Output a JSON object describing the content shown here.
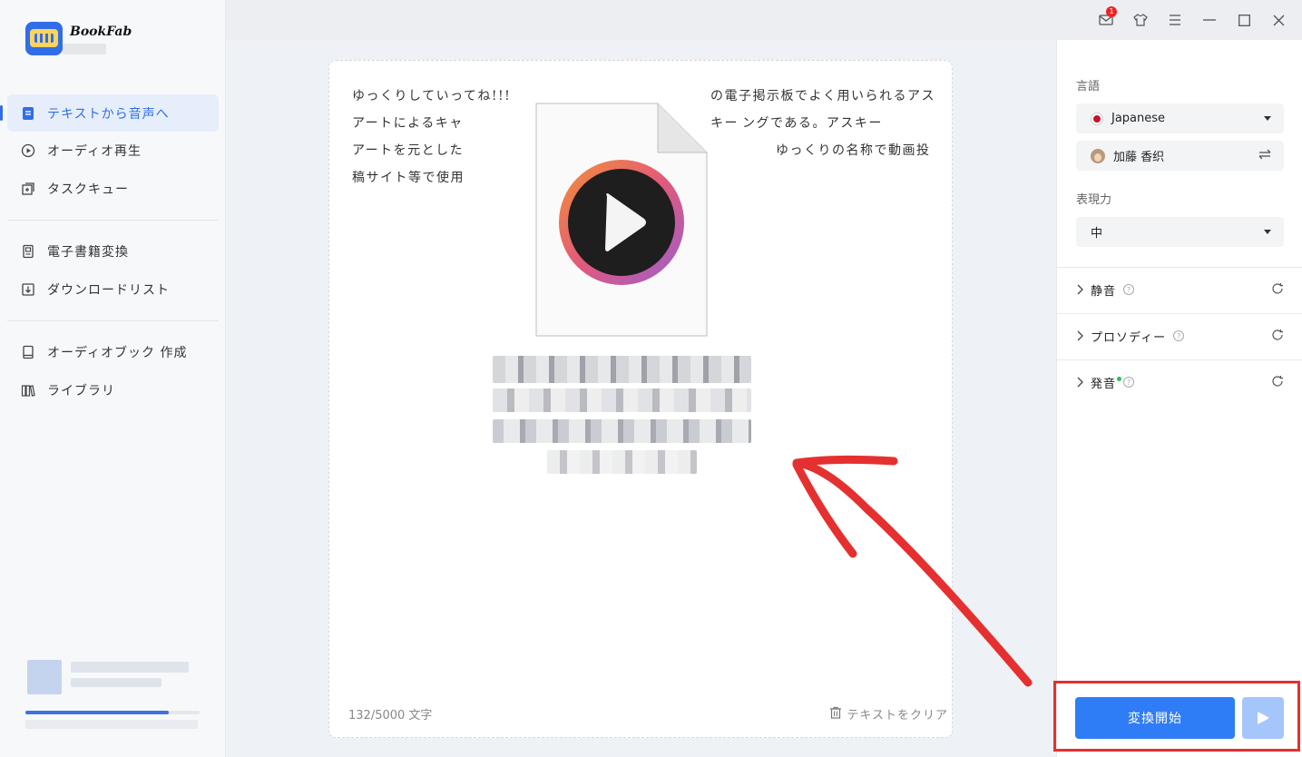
{
  "app": {
    "name": "BookFab"
  },
  "sidebar": {
    "items": [
      {
        "label": "テキストから音声へ",
        "icon": "document-icon",
        "active": true
      },
      {
        "label": "オーディオ再生",
        "icon": "play-circle-icon",
        "active": false
      },
      {
        "label": "タスクキュー",
        "icon": "task-queue-icon",
        "active": false
      },
      {
        "label": "電子書籍変換",
        "icon": "ebook-icon",
        "active": false
      },
      {
        "label": "ダウンロードリスト",
        "icon": "download-icon",
        "active": false
      },
      {
        "label": "オーディオブック 作成",
        "icon": "audiobook-icon",
        "active": false
      },
      {
        "label": "ライブラリ",
        "icon": "library-icon",
        "active": false
      }
    ]
  },
  "topbar": {
    "mail_badge": "1"
  },
  "editor": {
    "lines": [
      "ゆっくりしていってね!!!",
      "アートによるキャ",
      "アートを元とした",
      "稿サイト等で使用"
    ],
    "lines_right": [
      "の電子掲示板でよく用いられるアスキー",
      "ングである。アスキー",
      "ゆっくりの名称で動画投"
    ],
    "char_count": "132/5000 文字",
    "clear_label": "テキストをクリア"
  },
  "settings": {
    "language_label": "言語",
    "language_value": "Japanese",
    "voice_value": "加藤 香织",
    "expression_label": "表現力",
    "expression_value": "中",
    "sections": [
      {
        "label": "静音"
      },
      {
        "label": "プロソディー"
      },
      {
        "label": "発音"
      }
    ]
  },
  "actions": {
    "convert_label": "変換開始"
  },
  "colors": {
    "accent": "#2f7df6",
    "highlight": "#e53030",
    "play_disabled": "#a4c6fb"
  }
}
